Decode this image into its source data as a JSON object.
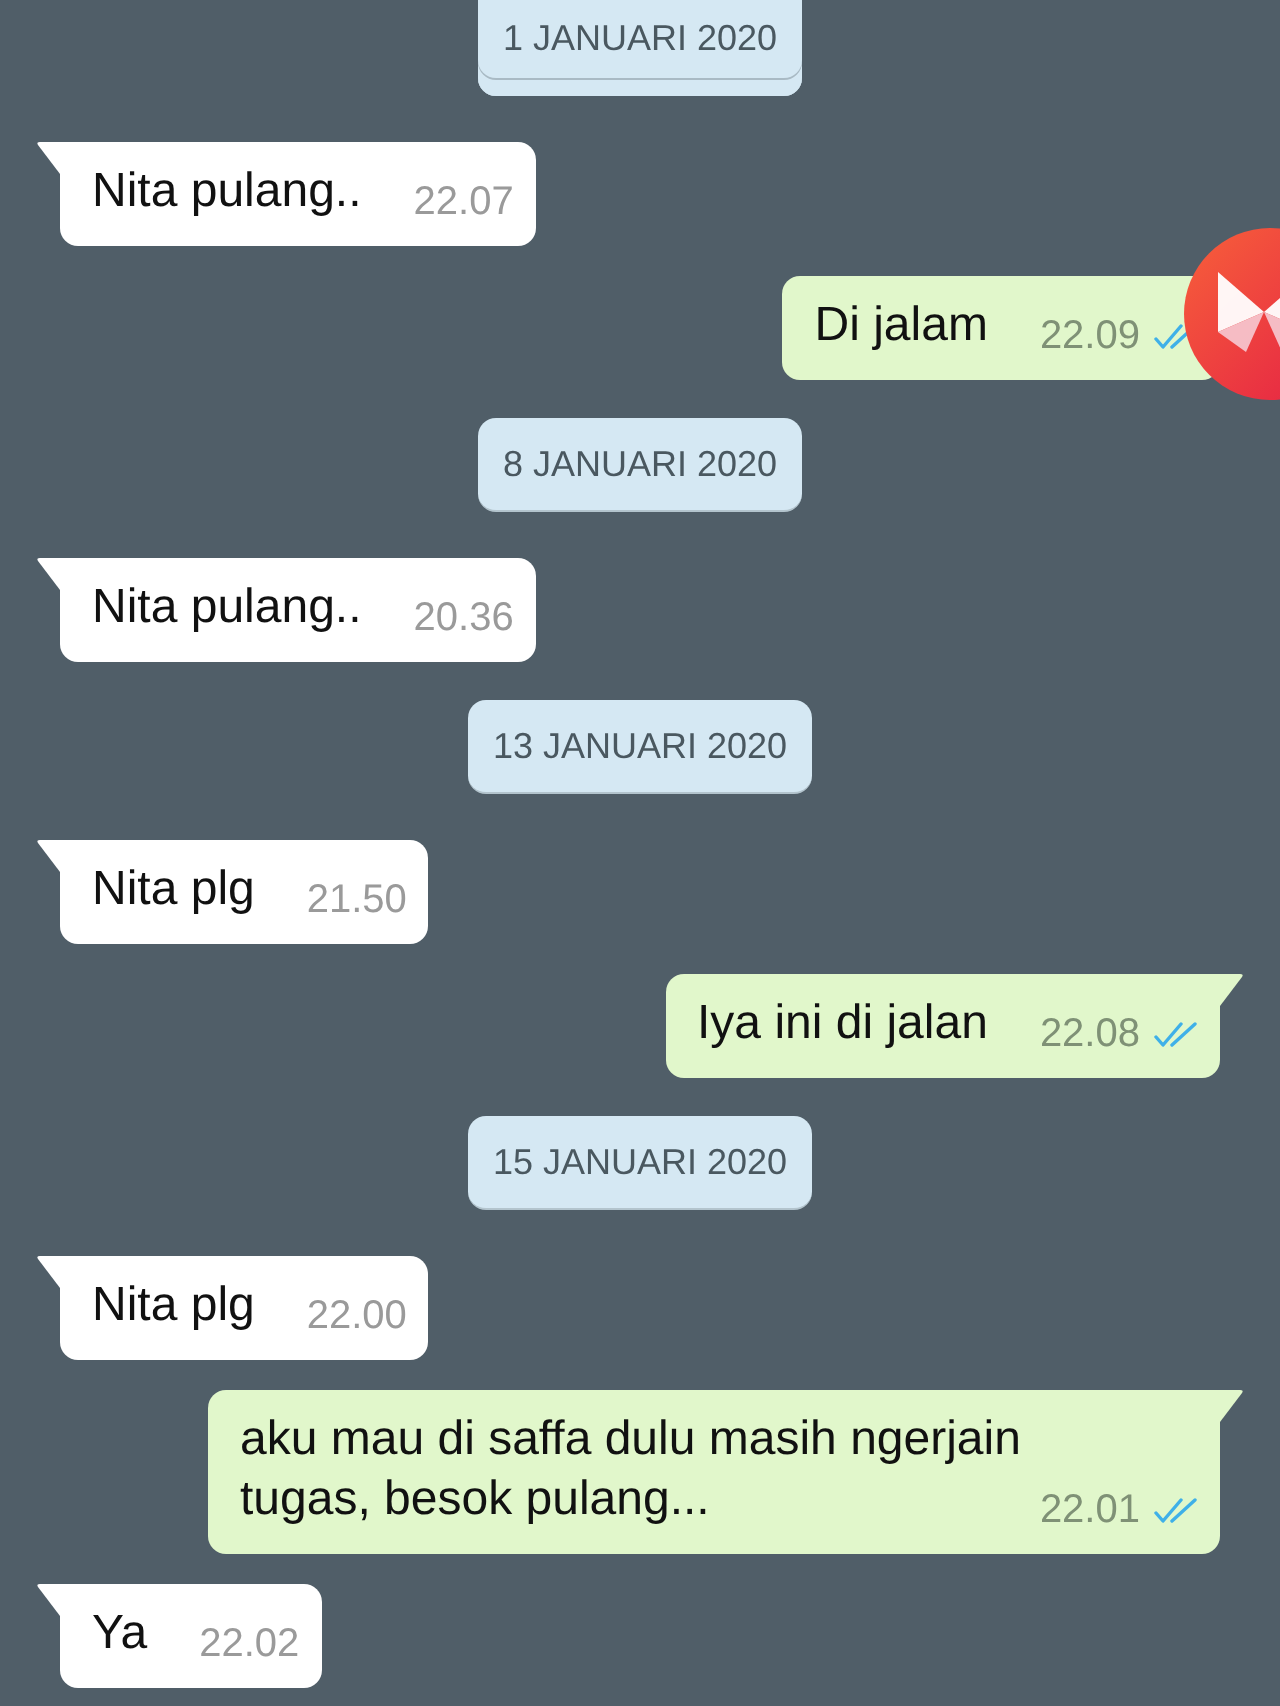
{
  "messages": [
    {
      "kind": "date",
      "label": "1 JANUARI 2020",
      "pinned": true
    },
    {
      "kind": "incoming",
      "text": "Nita pulang..",
      "time": "22.07"
    },
    {
      "kind": "outgoing",
      "text": "Di jalam",
      "time": "22.09",
      "read": true
    },
    {
      "kind": "date",
      "label": "8 JANUARI 2020",
      "pinned": false
    },
    {
      "kind": "incoming",
      "text": "Nita pulang..",
      "time": "20.36"
    },
    {
      "kind": "date",
      "label": "13 JANUARI 2020",
      "pinned": false
    },
    {
      "kind": "incoming",
      "text": "Nita plg",
      "time": "21.50"
    },
    {
      "kind": "outgoing",
      "text": "Iya ini di jalan",
      "time": "22.08",
      "read": true
    },
    {
      "kind": "date",
      "label": "15 JANUARI 2020",
      "pinned": false
    },
    {
      "kind": "incoming",
      "text": "Nita plg",
      "time": "22.00"
    },
    {
      "kind": "outgoing",
      "text": "aku mau di saffa dulu masih ngerjain tugas, besok pulang...",
      "time": "22.01",
      "read": true
    },
    {
      "kind": "incoming",
      "text": "Ya",
      "time": "22.02"
    }
  ]
}
